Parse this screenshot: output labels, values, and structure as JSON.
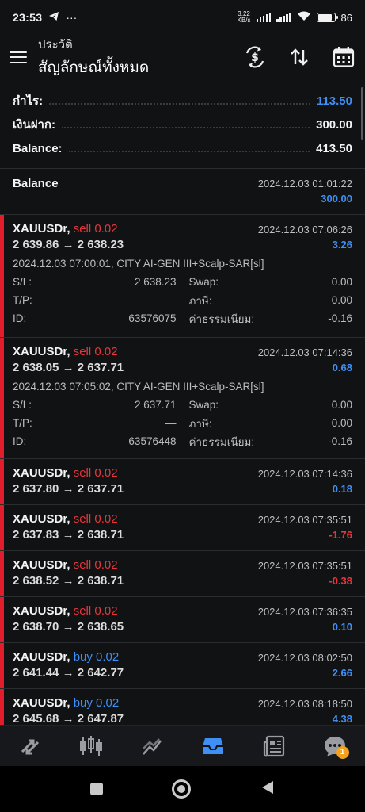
{
  "status": {
    "time": "23:53",
    "net_speed_top": "3.22",
    "net_speed_bottom": "KB/s",
    "battery": "86"
  },
  "header": {
    "subtitle": "ประวัติ",
    "title": "สัญลักษณ์ทั้งหมด"
  },
  "summary": [
    {
      "label": "กำไร:",
      "value": "113.50",
      "accent": true
    },
    {
      "label": "เงินฝาก:",
      "value": "300.00",
      "accent": false
    },
    {
      "label": "Balance:",
      "value": "413.50",
      "accent": false
    }
  ],
  "balance_entry": {
    "label": "Balance",
    "date": "2024.12.03 01:01:22",
    "amount": "300.00"
  },
  "labels": {
    "sl": "S/L:",
    "tp": "T/P:",
    "id": "ID:",
    "swap": "Swap:",
    "tax": "ภาษี:",
    "fee": "ค่าธรรมเนียม:",
    "arrow": "→"
  },
  "deals": [
    {
      "symbol": "XAUUSDr,",
      "side": " sell 0.02",
      "dir": "sell",
      "date": "2024.12.03 07:06:26",
      "open": "2 639.86",
      "close": "2 638.23",
      "profit": "3.26",
      "neg": false,
      "expanded": true,
      "comment": "2024.12.03 07:00:01, CITY AI-GEN III+Scalp-SAR[sl]",
      "sl": "2 638.23",
      "tp": "—",
      "id": "63576075",
      "swap": "0.00",
      "tax": "0.00",
      "fee": "-0.16"
    },
    {
      "symbol": "XAUUSDr,",
      "side": " sell 0.02",
      "dir": "sell",
      "date": "2024.12.03 07:14:36",
      "open": "2 638.05",
      "close": "2 637.71",
      "profit": "0.68",
      "neg": false,
      "expanded": true,
      "comment": "2024.12.03 07:05:02, CITY AI-GEN III+Scalp-SAR[sl]",
      "sl": "2 637.71",
      "tp": "—",
      "id": "63576448",
      "swap": "0.00",
      "tax": "0.00",
      "fee": "-0.16"
    },
    {
      "symbol": "XAUUSDr,",
      "side": " sell 0.02",
      "dir": "sell",
      "date": "2024.12.03 07:14:36",
      "open": "2 637.80",
      "close": "2 637.71",
      "profit": "0.18",
      "neg": false,
      "expanded": false
    },
    {
      "symbol": "XAUUSDr,",
      "side": " sell 0.02",
      "dir": "sell",
      "date": "2024.12.03 07:35:51",
      "open": "2 637.83",
      "close": "2 638.71",
      "profit": "-1.76",
      "neg": true,
      "expanded": false
    },
    {
      "symbol": "XAUUSDr,",
      "side": " sell 0.02",
      "dir": "sell",
      "date": "2024.12.03 07:35:51",
      "open": "2 638.52",
      "close": "2 638.71",
      "profit": "-0.38",
      "neg": true,
      "expanded": false
    },
    {
      "symbol": "XAUUSDr,",
      "side": " sell 0.02",
      "dir": "sell",
      "date": "2024.12.03 07:36:35",
      "open": "2 638.70",
      "close": "2 638.65",
      "profit": "0.10",
      "neg": false,
      "expanded": false
    },
    {
      "symbol": "XAUUSDr,",
      "side": " buy 0.02",
      "dir": "buy",
      "date": "2024.12.03 08:02:50",
      "open": "2 641.44",
      "close": "2 642.77",
      "profit": "2.66",
      "neg": false,
      "expanded": false
    },
    {
      "symbol": "XAUUSDr,",
      "side": " buy 0.02",
      "dir": "buy",
      "date": "2024.12.03 08:18:50",
      "open": "2 645.68",
      "close": "2 647.87",
      "profit": "4.38",
      "neg": false,
      "expanded": false
    }
  ],
  "nav": {
    "badge": "1"
  },
  "colors": {
    "accent": "#3f8ff5",
    "sell": "#e8353a",
    "bar": "#e21d2b",
    "background": "#111214"
  }
}
